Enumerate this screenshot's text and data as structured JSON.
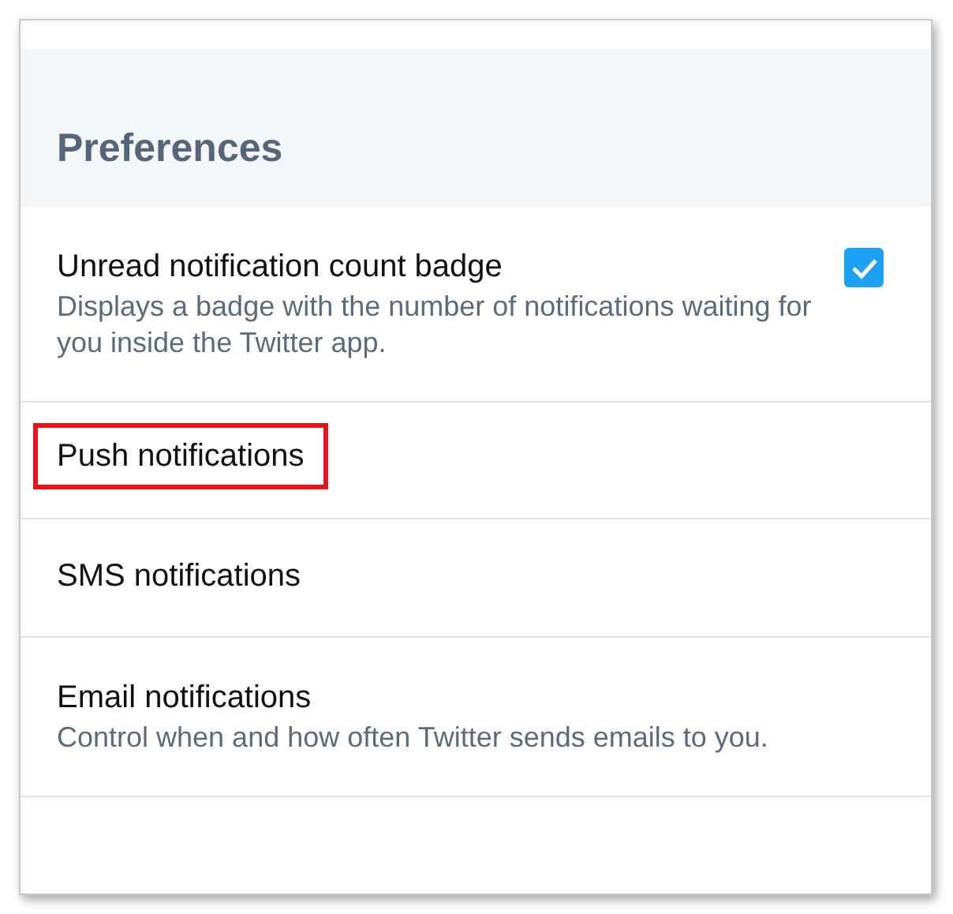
{
  "section": {
    "title": "Preferences"
  },
  "items": [
    {
      "kind": "checkbox",
      "label": "Unread notification count badge",
      "description": "Displays a badge with the number of notifications waiting for you inside the Twitter app.",
      "checked": true,
      "highlighted": false
    },
    {
      "kind": "plain",
      "label": "Push notifications",
      "highlighted": true
    },
    {
      "kind": "plain",
      "label": "SMS notifications",
      "highlighted": false
    },
    {
      "kind": "plain",
      "label": "Email notifications",
      "description": "Control when and how often Twitter sends emails to you.",
      "highlighted": false
    }
  ]
}
